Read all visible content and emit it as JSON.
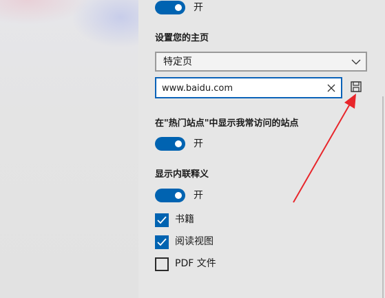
{
  "settings": {
    "top_toggle": {
      "state_label": "开",
      "on": true
    },
    "homepage": {
      "heading": "设置您的主页",
      "select_value": "特定页",
      "url_value": "www.baidu.com"
    },
    "top_sites": {
      "heading": "在\"热门站点\"中显示我常访问的站点",
      "state_label": "开",
      "on": true
    },
    "inline_definitions": {
      "heading": "显示内联释义",
      "state_label": "开",
      "on": true,
      "options": [
        {
          "label": "书籍",
          "checked": true
        },
        {
          "label": "阅读视图",
          "checked": true
        },
        {
          "label": "PDF 文件",
          "checked": false
        }
      ]
    }
  },
  "colors": {
    "accent": "#0063b1",
    "annotation_arrow": "#e8262b"
  },
  "icons": {
    "dropdown": "chevron-down-icon",
    "clear": "close-icon",
    "save": "save-icon"
  }
}
